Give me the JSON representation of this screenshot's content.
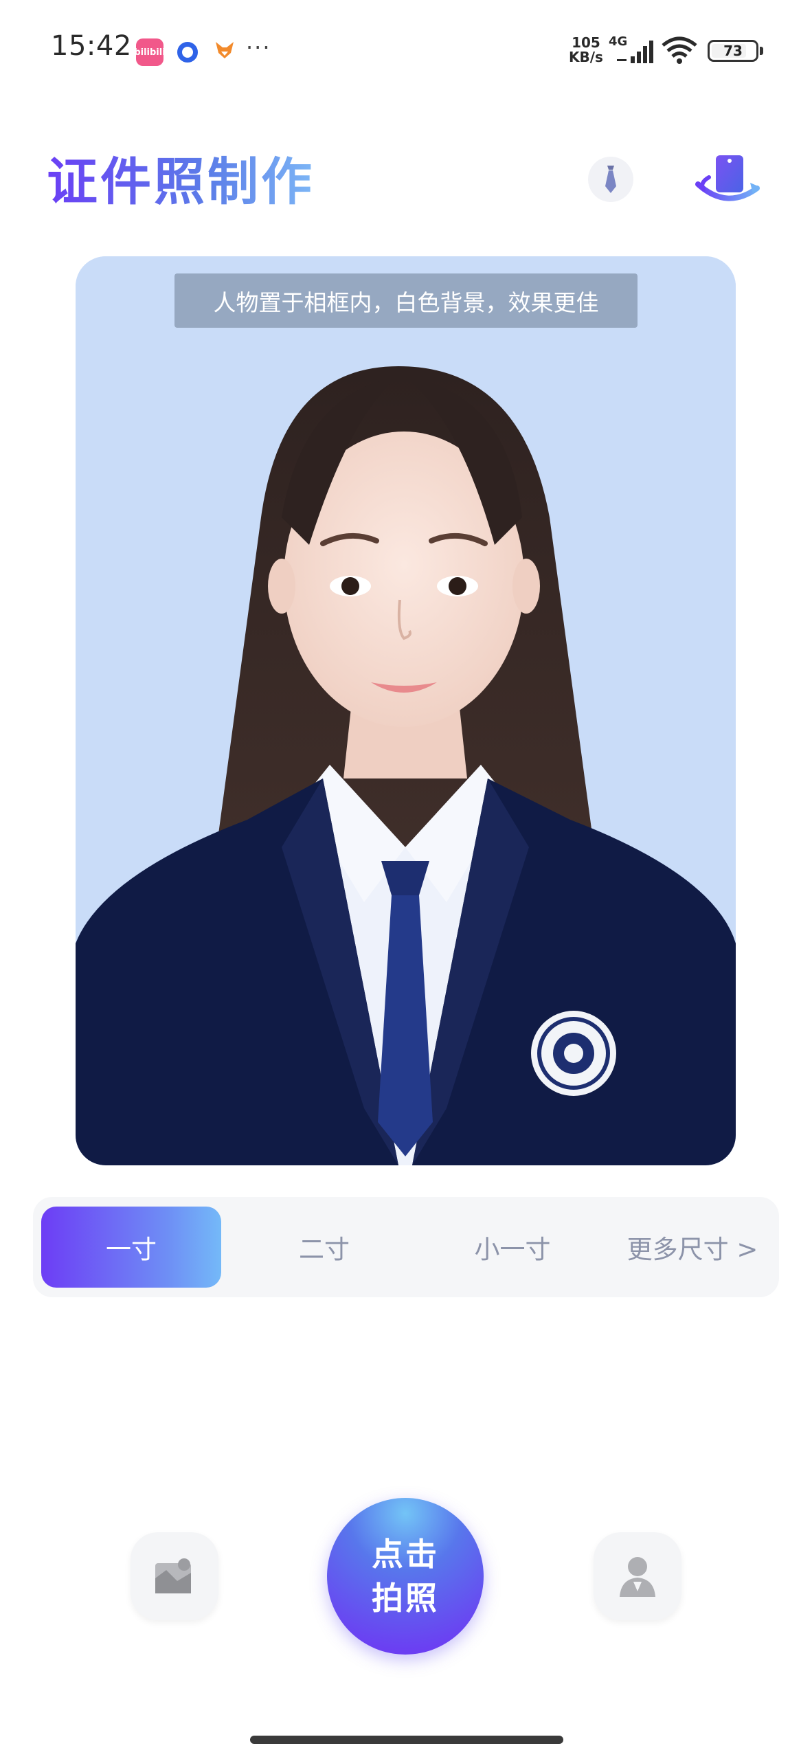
{
  "status_bar": {
    "time": "15:42",
    "notification_icons": [
      "bilibili-icon",
      "circle-app-icon",
      "fox-icon",
      "more-dots-icon"
    ],
    "bili_text": "bilibili",
    "more": "···",
    "net_speed_value": "105",
    "net_speed_unit": "KB/s",
    "network_type": "4G",
    "battery": "73"
  },
  "header": {
    "title": "证件照制作",
    "tie_icon": "tie-icon",
    "swap_icon": "swap-phone-icon"
  },
  "photo": {
    "hint": "人物置于相框内，白色背景，效果更佳",
    "background_color": "#c9dcf8"
  },
  "size_tabs": {
    "selected": "一寸",
    "items": [
      {
        "label": "一寸"
      },
      {
        "label": "二寸"
      },
      {
        "label": "小一寸"
      },
      {
        "label": "更多尺寸 >"
      }
    ]
  },
  "actions": {
    "gallery_icon": "gallery-icon",
    "shutter_line1": "点击",
    "shutter_line2": "拍照",
    "profile_icon": "person-icon"
  },
  "colors": {
    "accent_start": "#6a3ff5",
    "accent_end": "#74b9f8",
    "tab_inactive_text": "#8c93a9"
  }
}
